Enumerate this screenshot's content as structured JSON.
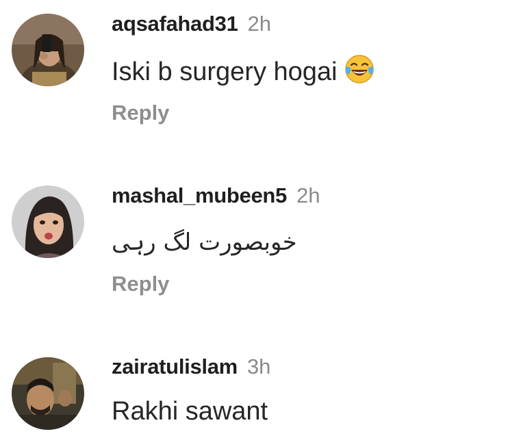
{
  "comments": [
    {
      "username": "aqsafahad31",
      "time": "2h",
      "text": "Iski b surgery hogai",
      "emoji": "face-with-tears-of-joy",
      "reply_label": "Reply"
    },
    {
      "username": "mashal_mubeen5",
      "time": "2h",
      "text": "خوبصورت لگ رہی",
      "reply_label": "Reply"
    },
    {
      "username": "zairatulislam",
      "time": "3h",
      "text": "Rakhi sawant"
    }
  ]
}
